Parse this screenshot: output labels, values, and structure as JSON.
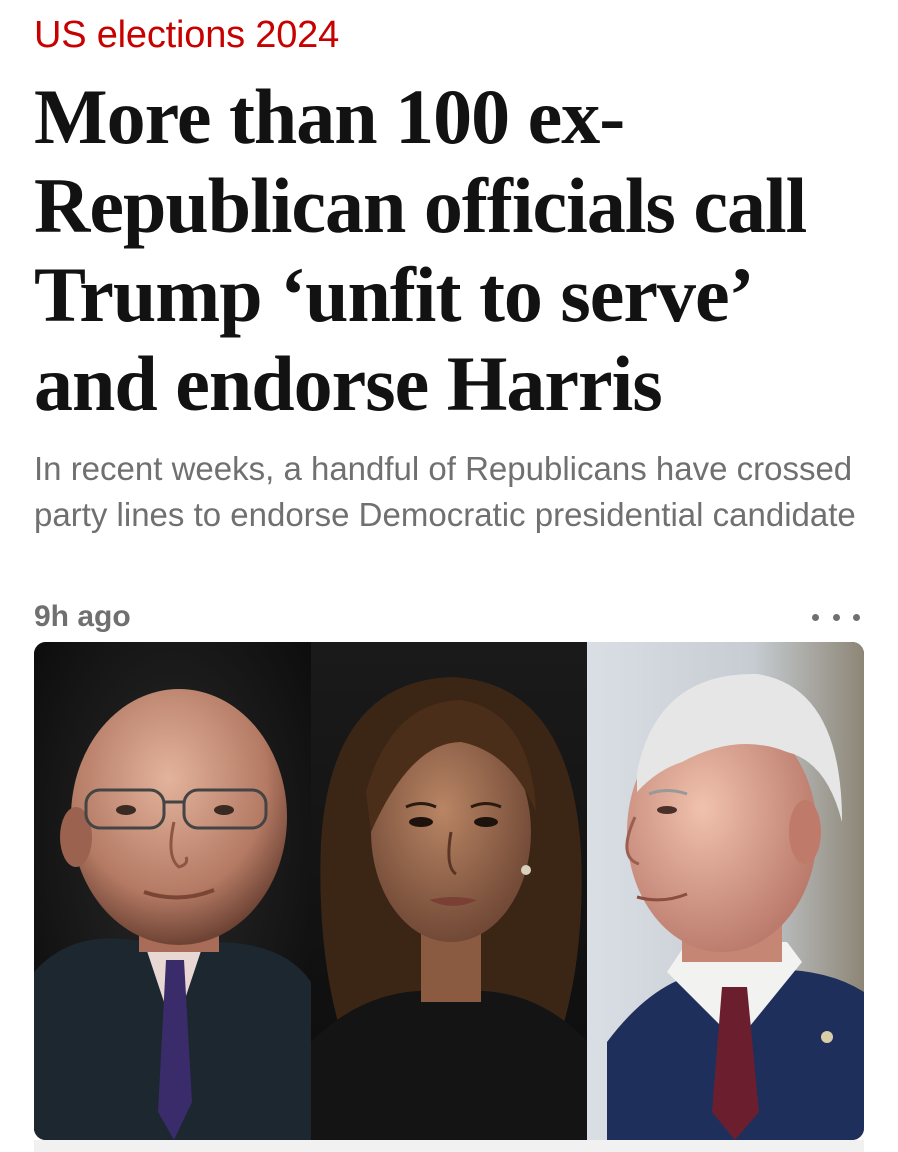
{
  "article": {
    "kicker": "US elections 2024",
    "headline": "More than 100 ex-Republican officials call Trump ‘unfit to serve’ and endorse Harris",
    "standfirst": "In recent weeks, a handful of Republicans have crossed party lines to endorse Democratic presidential candidate",
    "timestamp": "9h ago",
    "more_icon": "more-horizontal-icon"
  },
  "colors": {
    "kicker": "#c70000",
    "headline": "#121212",
    "meta": "#707070"
  }
}
